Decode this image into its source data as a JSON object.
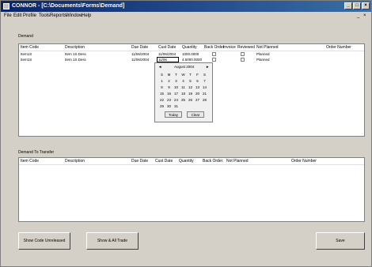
{
  "window": {
    "title": "CONNOR - [C:\\Documents\\Forms\\Demand]"
  },
  "menubar": {
    "items": [
      "File",
      "Edit",
      "Profile",
      "Tools",
      "Reports",
      "Window",
      "Help"
    ]
  },
  "demand": {
    "label": "Demand",
    "columns": [
      "Item Code",
      "Description",
      "Due Date",
      "Cust Date",
      "Quantity",
      "Back Order",
      "Invoice",
      "Reviewed",
      "Not Planned",
      "Order Number"
    ],
    "rows": [
      {
        "item_code": "Item1S",
        "description": "Item 1S Desc",
        "due_date": "11/06/2004",
        "cust_date": "11/06/2004",
        "quantity": "1000.0000",
        "not_planned": "Planned"
      },
      {
        "item_code": "Item1S",
        "description": "Item 1S Desc",
        "due_date": "11/06/2004",
        "cust_date": "11/06",
        "quantity": "4.5000.0000",
        "not_planned": "Planned"
      }
    ]
  },
  "calendar": {
    "month_label": "August 2004",
    "weekdays": [
      "S",
      "M",
      "T",
      "W",
      "T",
      "F",
      "S"
    ],
    "weeks": [
      [
        "1",
        "2",
        "3",
        "4",
        "5",
        "6",
        "7"
      ],
      [
        "8",
        "9",
        "10",
        "11",
        "12",
        "13",
        "14"
      ],
      [
        "15",
        "16",
        "17",
        "18",
        "19",
        "20",
        "21"
      ],
      [
        "22",
        "23",
        "24",
        "25",
        "26",
        "27",
        "28"
      ],
      [
        "29",
        "30",
        "31",
        "",
        "",
        "",
        ""
      ]
    ],
    "today_button": "Today",
    "clear_button": "Clear"
  },
  "transfer": {
    "label": "Demand To Transfer",
    "columns": [
      "Item Code",
      "Description",
      "Due Date",
      "Cust Date",
      "Quantity",
      "Back Order",
      "Not Planned",
      "Order Number"
    ]
  },
  "buttons": {
    "show_unreleased": "Show Code Unreleased",
    "show_all_trade": "Show & All Trade",
    "save": "Save"
  }
}
